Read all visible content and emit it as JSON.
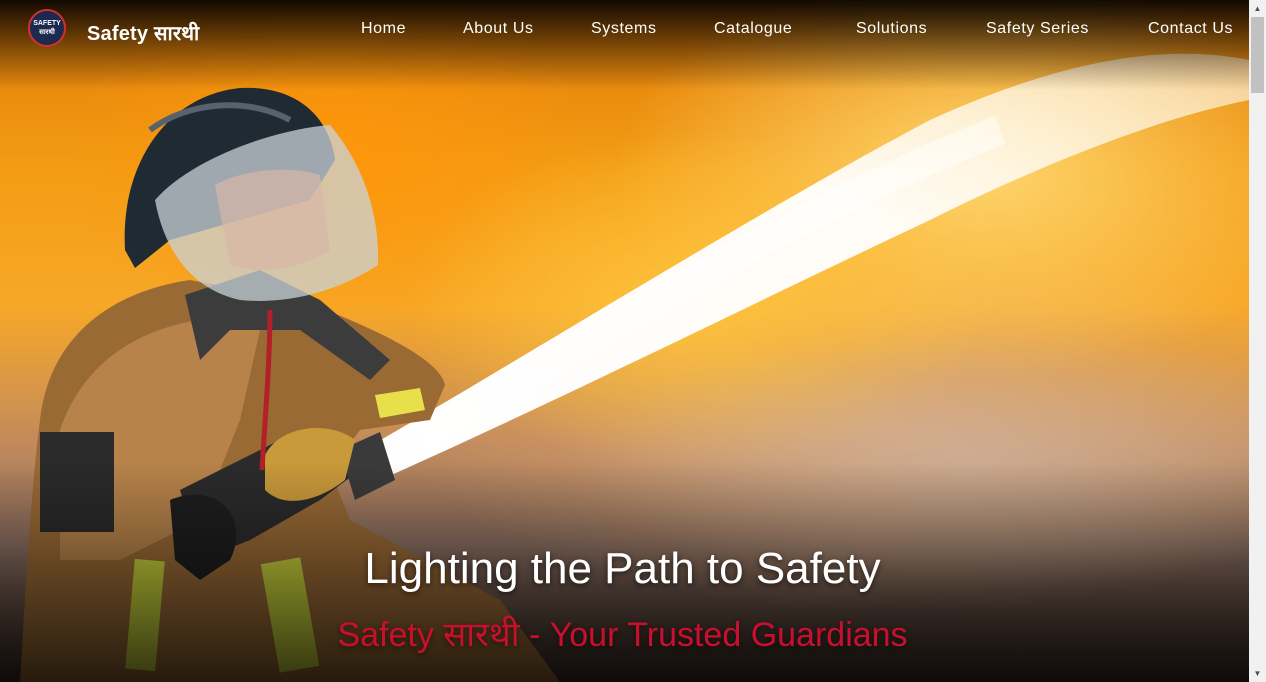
{
  "header": {
    "logo": {
      "line1": "SAFETY",
      "line2": "सारथी"
    },
    "brand_name": "Safety सारथी",
    "nav": [
      {
        "label": "Home"
      },
      {
        "label": "About Us"
      },
      {
        "label": "Systems"
      },
      {
        "label": "Catalogue"
      },
      {
        "label": "Solutions"
      },
      {
        "label": "Safety Series"
      },
      {
        "label": "Contact Us"
      }
    ]
  },
  "hero": {
    "headline": "Lighting the Path to Safety",
    "tagline": "Safety सारथी - Your Trusted Guardians",
    "tagline_color": "#c8102e",
    "image_subject": "firefighter-spraying-water-on-fire"
  },
  "scrollbar": {
    "up_icon": "scroll-up-arrow",
    "down_icon": "scroll-down-arrow"
  }
}
